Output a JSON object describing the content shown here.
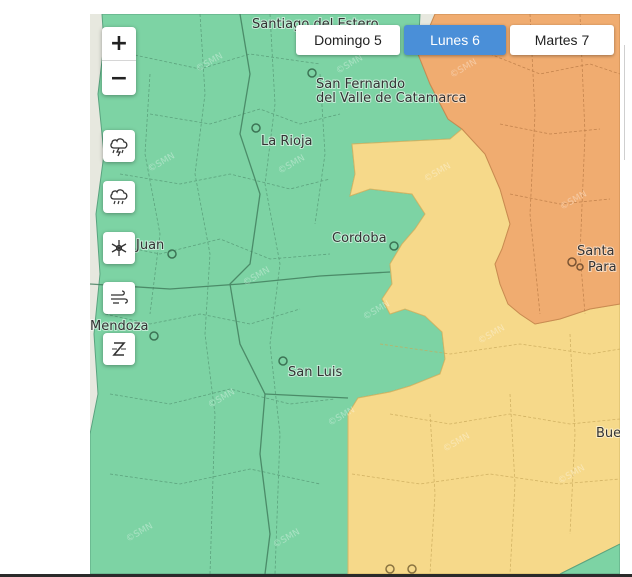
{
  "map": {
    "colors": {
      "green_zone": "#7dd3a4",
      "yellow_zone": "#f6d98a",
      "orange_zone": "#f0ac70",
      "land_gray": "#e7e8df",
      "border": "#4f8e6d",
      "active_tab": "#4a8fd8"
    },
    "cities": [
      {
        "name": "Santiago del Estero"
      },
      {
        "name": "San Fernando"
      },
      {
        "name": "del Valle de Catamarca"
      },
      {
        "name": "La Rioja"
      },
      {
        "name": "Cordoba"
      },
      {
        "name": "Juan"
      },
      {
        "name": "Mendoza"
      },
      {
        "name": "San Luis"
      },
      {
        "name": "Santa"
      },
      {
        "name": "Para"
      },
      {
        "name": "Bue"
      }
    ],
    "watermark": "©SMN"
  },
  "zoom": {
    "in_label": "+",
    "out_label": "−"
  },
  "layers": [
    {
      "icon": "thunderstorm-icon"
    },
    {
      "icon": "rain-icon"
    },
    {
      "icon": "snow-icon"
    },
    {
      "icon": "wind-icon"
    },
    {
      "icon": "zonda-wind-icon"
    }
  ],
  "day_tabs": [
    {
      "label": "Domingo 5",
      "active": false
    },
    {
      "label": "Lunes 6",
      "active": true
    },
    {
      "label": "Martes 7",
      "active": false
    }
  ]
}
